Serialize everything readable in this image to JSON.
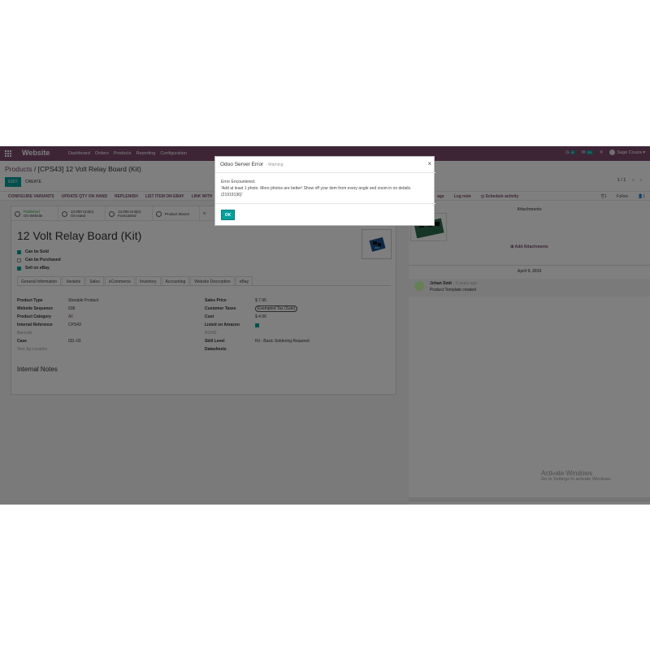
{
  "navbar": {
    "brand": "Website",
    "menu": [
      "Dashboard",
      "Orders",
      "Products",
      "Reporting",
      "Configuration"
    ],
    "activity_count": "8",
    "messages_count": "20",
    "user": "Sage Couza"
  },
  "breadcrumb": {
    "root": "Products",
    "separator": "/",
    "current": "[CPS43] 12 Volt Relay Board (Kit)"
  },
  "buttons": {
    "edit": "EDIT",
    "create": "CREATE"
  },
  "pager": {
    "value": "1 / 1",
    "prev": "‹",
    "next": "›"
  },
  "statusbar": {
    "actions": [
      "CONFIGURE VARIANTS",
      "UPDATE QTY ON HAND",
      "REPLENISH",
      "LIST ITEM ON EBAY",
      "LINK WITH"
    ],
    "chatter_actions": [
      "age",
      "Log note",
      "Schedule activity"
    ],
    "followers": "1",
    "follow": "Follow",
    "attachments": "1"
  },
  "smart_buttons": [
    {
      "line1": "Published",
      "line2": "On Website"
    },
    {
      "line1": "13.000 Unit(s)",
      "line2": "On Hand"
    },
    {
      "line1": "13.000 Unit(s)",
      "line2": "Forecasted"
    },
    {
      "line1": "Product Moves",
      "line2": ""
    }
  ],
  "product": {
    "name": "12 Volt Relay Board (Kit)",
    "flags": [
      {
        "label": "Can be Sold",
        "checked": true
      },
      {
        "label": "Can be Purchased",
        "checked": false
      },
      {
        "label": "Sell on eBay",
        "checked": true
      }
    ]
  },
  "tabs": [
    "General Information",
    "Variants",
    "Sales",
    "eCommerce",
    "Inventory",
    "Accounting",
    "Website Description",
    "eBay"
  ],
  "fields_left": [
    {
      "label": "Product Type",
      "value": "Storable Product"
    },
    {
      "label": "Website Sequence",
      "value": "638"
    },
    {
      "label": "Product Category",
      "value": "All"
    },
    {
      "label": "Internal Reference",
      "value": "CPS43"
    },
    {
      "label": "Barcode",
      "value": ""
    },
    {
      "label": "Case",
      "value": "02L-03"
    },
    {
      "label": "Test Jig Location",
      "value": ""
    }
  ],
  "fields_right": [
    {
      "label": "Sales Price",
      "value": "$ 7.95"
    },
    {
      "label": "Customer Taxes",
      "value": "Exempted Tax (Sale)"
    },
    {
      "label": "Cost",
      "value": "$ 4.56"
    },
    {
      "label": "Listed on Amazon",
      "value": ""
    },
    {
      "label": "ROHS",
      "value": ""
    },
    {
      "label": "Skill Level",
      "value": "Kit - Basic Soldering Required"
    },
    {
      "label": "Datasheets",
      "value": ""
    }
  ],
  "internal_notes": "Internal Notes",
  "chatter": {
    "attachments_title": "Attachments",
    "add_attachments": "Add Attachments",
    "date": "April 9, 2015",
    "message": {
      "author": "Johan Smit",
      "time": "- 5 years ago",
      "body": "Product Template created"
    }
  },
  "watermark": {
    "title": "Activate Windows",
    "sub": "Go to Settings to activate Windows."
  },
  "dialog": {
    "title": "Odoo Server Error",
    "subtitle": "- Warning",
    "close": "×",
    "line1": "Error Encountered.",
    "line2": "'Add at least 1 photo. More photos are better! Show off your item from every angle and zoom in on details.",
    "line3": "(21919136)'",
    "ok": "OK"
  }
}
